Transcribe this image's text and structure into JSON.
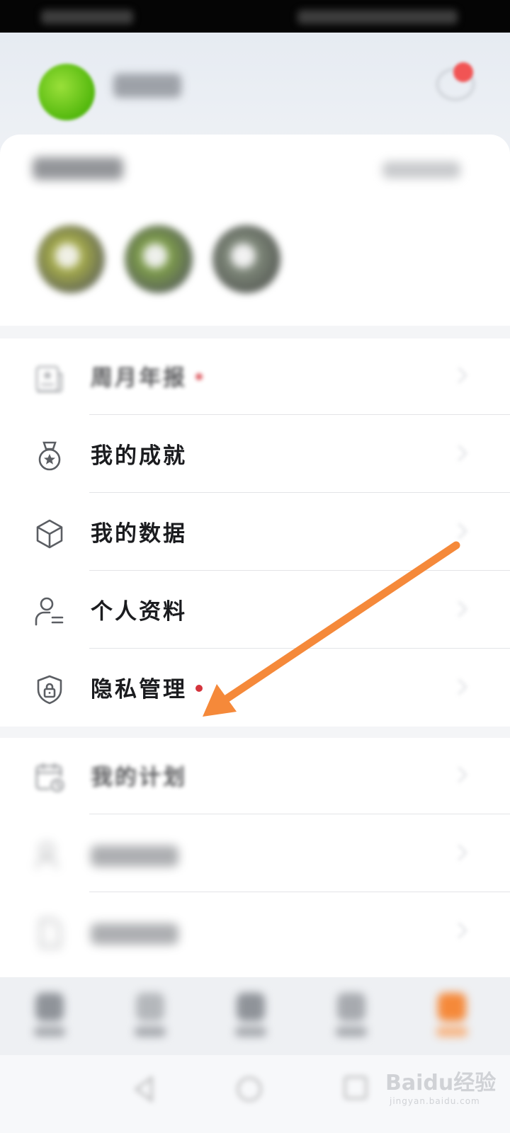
{
  "menu_group_1": [
    {
      "label": "周月年报",
      "icon": "report-icon",
      "dot": true,
      "dimmed": true
    },
    {
      "label": "我的成就",
      "icon": "medal-icon",
      "dot": false,
      "dimmed": false
    },
    {
      "label": "我的数据",
      "icon": "cube-icon",
      "dot": false,
      "dimmed": false
    },
    {
      "label": "个人资料",
      "icon": "person-icon",
      "dot": false,
      "dimmed": false
    },
    {
      "label": "隐私管理",
      "icon": "shield-lock-icon",
      "dot": true,
      "dimmed": false
    }
  ],
  "menu_group_2": [
    {
      "label": "我的计划",
      "icon": "calendar-clock-icon",
      "dimmed": true
    }
  ],
  "annotation": {
    "arrow_color": "#f5893a",
    "points_to": "隐私管理"
  },
  "colors": {
    "accent_dot": "#d4343c",
    "avatar": "#6cc81f",
    "tab_active": "#f5893a"
  },
  "watermark": {
    "brand": "Baidu经验",
    "url": "jingyan.baidu.com"
  }
}
